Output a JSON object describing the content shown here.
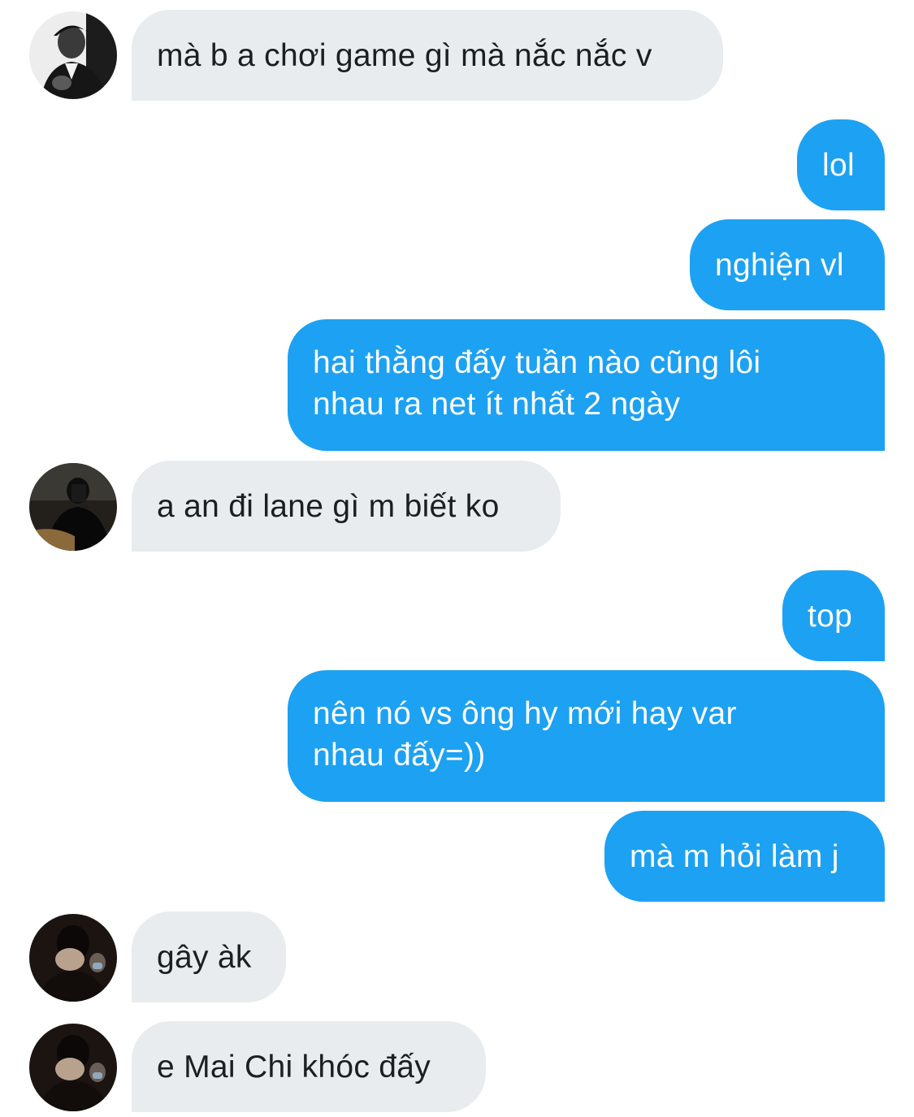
{
  "conversation": {
    "messages": [
      {
        "side": "in",
        "text": "mà b a chơi game gì mà nắc nắc v",
        "avatar": "avatar-man-suit"
      },
      {
        "side": "out",
        "text": "lol"
      },
      {
        "side": "out",
        "text": "nghiện vl"
      },
      {
        "side": "out",
        "text": "hai thằng đấy tuần nào cũng lôi nhau ra net ít nhất 2 ngày"
      },
      {
        "side": "in",
        "text": "a an đi lane gì m biết ko",
        "avatar": "avatar-man-phone"
      },
      {
        "side": "out",
        "text": "top"
      },
      {
        "side": "out",
        "text": "nên nó vs ông hy mới hay var nhau đấy=))"
      },
      {
        "side": "out",
        "text": "mà m hỏi làm j"
      },
      {
        "side": "in",
        "text": "gây àk",
        "avatar": "avatar-man-face-covered"
      },
      {
        "side": "in",
        "text": "e Mai Chi khóc đấy",
        "avatar": "avatar-man-face-covered"
      }
    ]
  },
  "colors": {
    "incoming_bubble": "#e8ecef",
    "incoming_text": "#1a1f24",
    "outgoing_bubble": "#1da1f2",
    "outgoing_text": "#ffffff",
    "background": "#ffffff"
  }
}
